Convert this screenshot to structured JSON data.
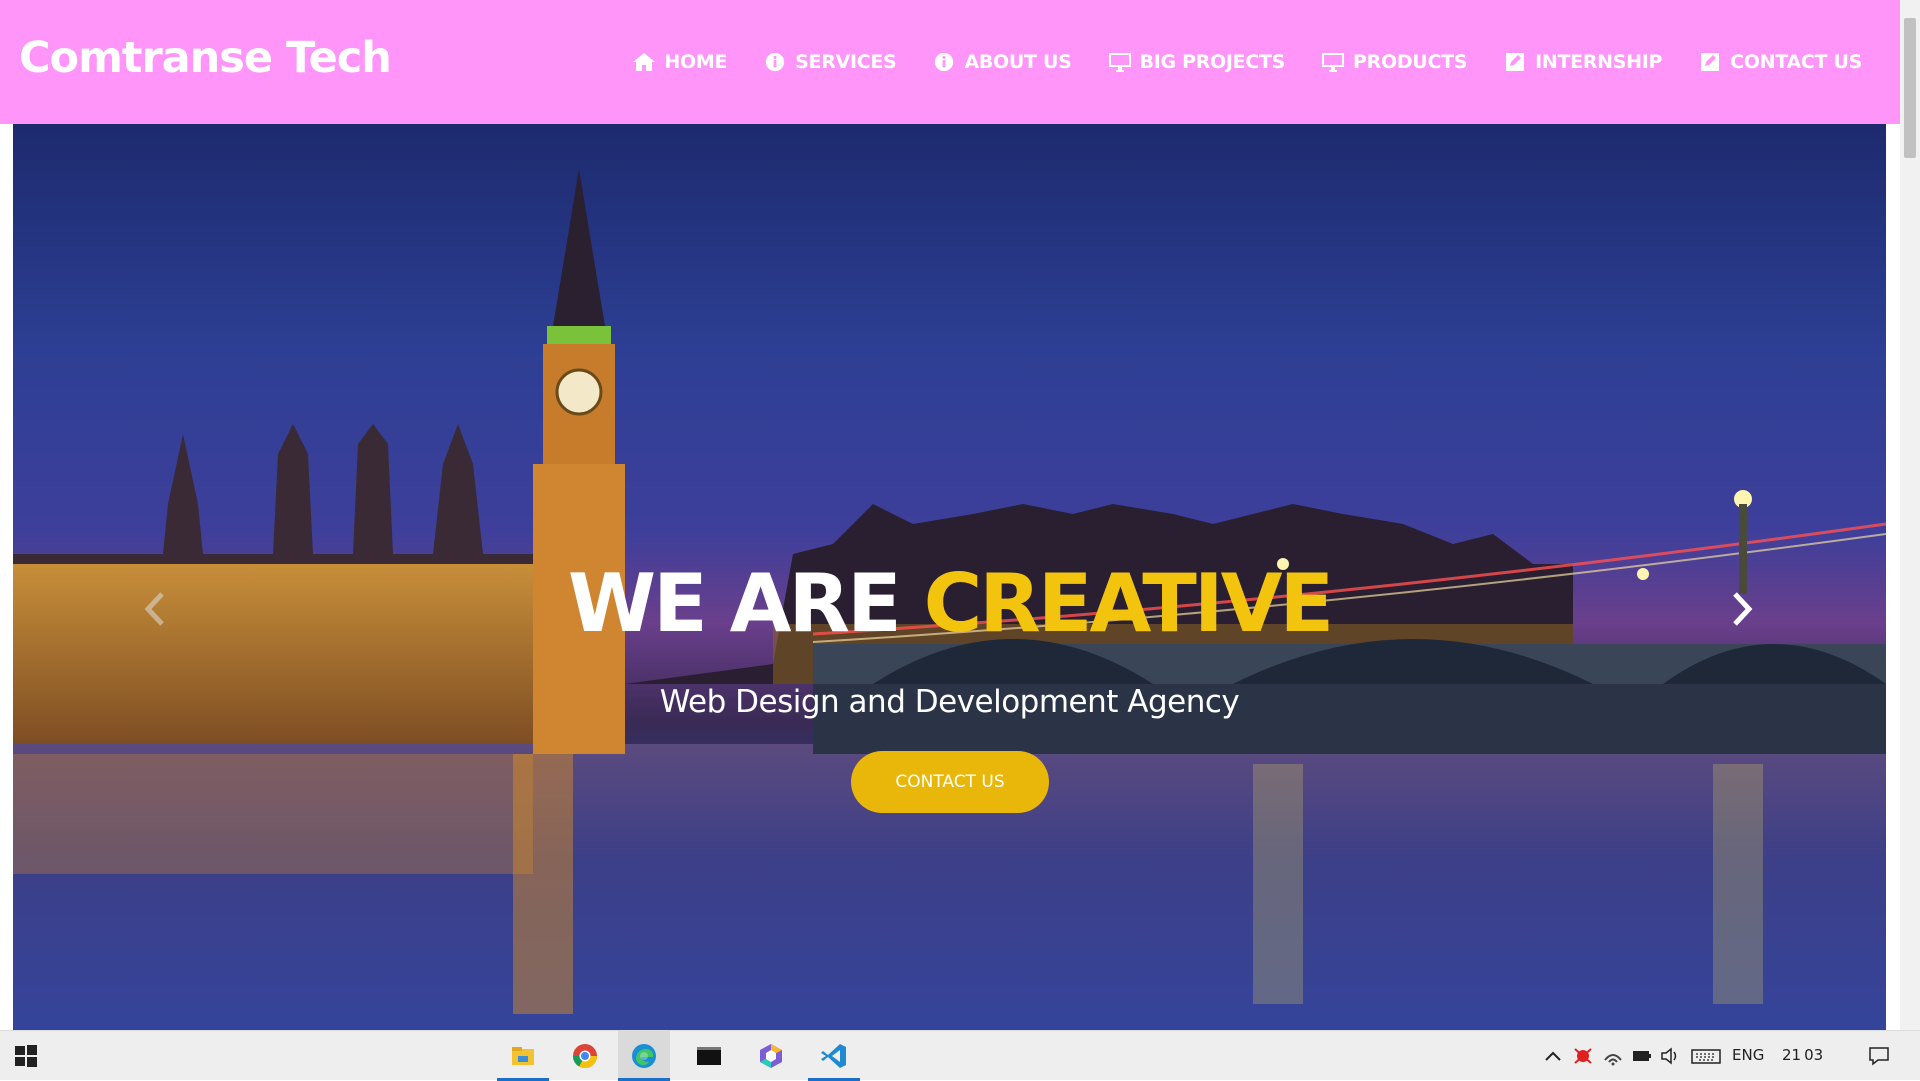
{
  "header": {
    "brand": "Comtranse Tech",
    "nav": [
      {
        "label": "HOME",
        "icon": "home-icon"
      },
      {
        "label": "SERVICES",
        "icon": "info-icon"
      },
      {
        "label": "ABOUT US",
        "icon": "info-icon"
      },
      {
        "label": "BIG PROJECTS",
        "icon": "monitor-icon"
      },
      {
        "label": "PRODUCTS",
        "icon": "monitor-icon"
      },
      {
        "label": "INTERNSHIP",
        "icon": "edit-icon"
      },
      {
        "label": "CONTACT US",
        "icon": "edit-icon"
      }
    ],
    "background_color": "#ff95f9"
  },
  "hero": {
    "title_white": "WE ARE",
    "title_yellow": "CREATIVE",
    "subtitle": "Web Design and Development Agency",
    "button_label": "CONTACT US",
    "accent_color": "#f2c40d",
    "prev_icon": "chevron-left-icon",
    "next_icon": "chevron-right-icon"
  },
  "taskbar": {
    "apps": [
      "file-explorer-icon",
      "chrome-icon",
      "edge-icon",
      "terminal-icon",
      "hexagon-app-icon",
      "vscode-icon"
    ],
    "tray": {
      "language": "ENG",
      "clock": "21 03"
    }
  }
}
